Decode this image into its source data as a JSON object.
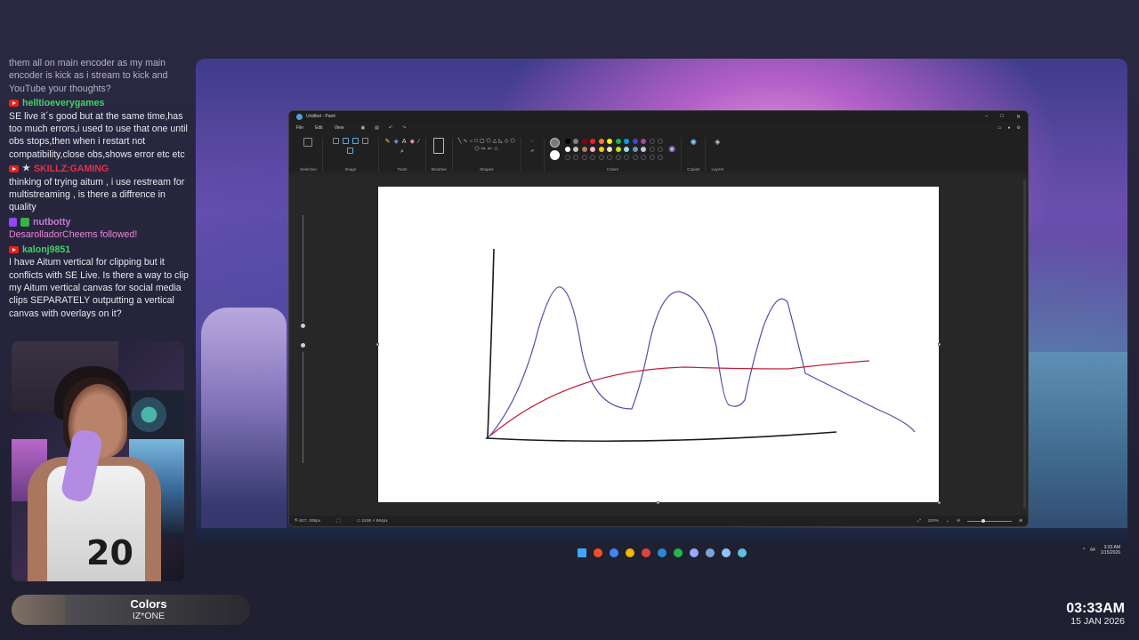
{
  "chat": {
    "messages": [
      {
        "type": "text",
        "faded": true,
        "text": "them all on main encoder as my main encoder is kick as i stream to kick and YouTube your thoughts?"
      },
      {
        "type": "user",
        "platform": "youtube",
        "name": "helltioeverygames",
        "color": "#44d16a"
      },
      {
        "type": "text",
        "text": "SE live it´s good but at the same time,has too much errors,i used to use that one until obs stops,then when i restart not compatibility,close obs,shows error etc etc"
      },
      {
        "type": "user",
        "platform": "youtube",
        "star": true,
        "name": "SKILLZ:GAMING",
        "color": "#e2324a"
      },
      {
        "type": "text",
        "text": "thinking of trying aitum , i use restream for multistreaming , is there a diffrence in quality"
      },
      {
        "type": "user",
        "platform": "twitch",
        "sub": true,
        "name": "nutbotty",
        "color": "#c57ad6"
      },
      {
        "type": "follow",
        "text": "DesarolladorCheems followed!"
      },
      {
        "type": "user",
        "platform": "youtube",
        "name": "kalonj9851",
        "color": "#44d16a"
      },
      {
        "type": "text",
        "text": "I have Aitum vertical for clipping but it conflicts with SE Live. Is there a way to clip my Aitum vertical canvas for social media clips SEPARATELY outputting a vertical canvas with overlays on it?"
      }
    ]
  },
  "webcam": {
    "jersey_number": "20"
  },
  "now_playing": {
    "title": "Colors",
    "artist": "IZ*ONE"
  },
  "clock": {
    "time": "03:33AM",
    "date": "15 JAN 2026"
  },
  "paint": {
    "title": "Untitled - Paint",
    "menu": [
      "File",
      "Edit",
      "View"
    ],
    "ribbon_groups": [
      "Selection",
      "Image",
      "Tools",
      "Brushes",
      "Shapes",
      "Colors",
      "Copilot",
      "Layers"
    ],
    "colors": {
      "primary": "#7a7a7a",
      "secondary": "#ffffff",
      "palette_row1": [
        "#000000",
        "#7f7f7f",
        "#880015",
        "#ed1c24",
        "#ff7f27",
        "#fff200",
        "#22b14c",
        "#00a2e8",
        "#3f48cc",
        "#a349a4"
      ],
      "palette_row2": [
        "#ffffff",
        "#c3c3c3",
        "#b97a57",
        "#ffaec9",
        "#ffc90e",
        "#efe4b0",
        "#b5e61d",
        "#99d9ea",
        "#7092be",
        "#c8bfe7"
      ]
    },
    "status": {
      "cursor": "607, 308px",
      "canvas_size": "1536 × 864px",
      "zoom": "100%"
    }
  },
  "taskbar": {
    "icon_colors": [
      "#3ea6ff",
      "#f25022",
      "#4285f4",
      "#f4b400",
      "#e04343",
      "#2b88d8",
      "#1db954",
      "#9aa8ff",
      "#7aa6d6",
      "#8ec5ff",
      "#5bc0de"
    ],
    "tray_time": "3:33 AM",
    "tray_date": "1/15/2026",
    "tray_battery": "64"
  }
}
